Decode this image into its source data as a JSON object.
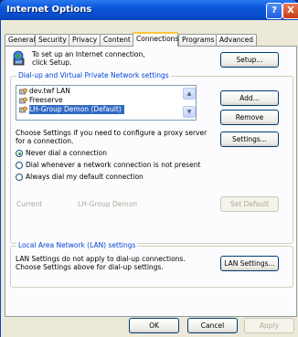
{
  "window": {
    "title": "Internet Options",
    "help_glyph": "?",
    "close_glyph": "X"
  },
  "tabs": [
    {
      "label": "General",
      "active": false
    },
    {
      "label": "Security",
      "active": false
    },
    {
      "label": "Privacy",
      "active": false
    },
    {
      "label": "Content",
      "active": false
    },
    {
      "label": "Connections",
      "active": true
    },
    {
      "label": "Programs",
      "active": false
    },
    {
      "label": "Advanced",
      "active": false
    }
  ],
  "setup": {
    "text": "To set up an Internet connection, click Setup.",
    "button": "Setup..."
  },
  "dialup": {
    "group_title": "Dial-up and Virtual Private Network settings",
    "connections": [
      {
        "label": "dev.twf LAN",
        "selected": false
      },
      {
        "label": "Freeserve",
        "selected": false
      },
      {
        "label": "LH-Group Demon (Default)",
        "selected": true
      }
    ],
    "add_button": "Add...",
    "remove_button": "Remove",
    "proxy_text": "Choose Settings if you need to configure a proxy server for a connection.",
    "settings_button": "Settings...",
    "radios": [
      {
        "label": "Never dial a connection",
        "checked": true
      },
      {
        "label": "Dial whenever a network connection is not present",
        "checked": false
      },
      {
        "label": "Always dial my default connection",
        "checked": false
      }
    ],
    "current_label": "Current",
    "current_value": "LH-Group Demon",
    "set_default_button": "Set Default"
  },
  "lan": {
    "group_title": "Local Area Network (LAN) settings",
    "text": "LAN Settings do not apply to dial-up connections. Choose Settings above for dial-up settings.",
    "button": "LAN Settings..."
  },
  "footer": {
    "ok": "OK",
    "cancel": "Cancel",
    "apply": "Apply"
  },
  "icons": {
    "globe": "globe-computer-icon",
    "dialup": "dialup-connection-icon"
  },
  "colors": {
    "title_blue": "#0a55d8",
    "group_title": "#0046d5",
    "selection": "#316ac5",
    "dialog_bg": "#ece9d8"
  }
}
